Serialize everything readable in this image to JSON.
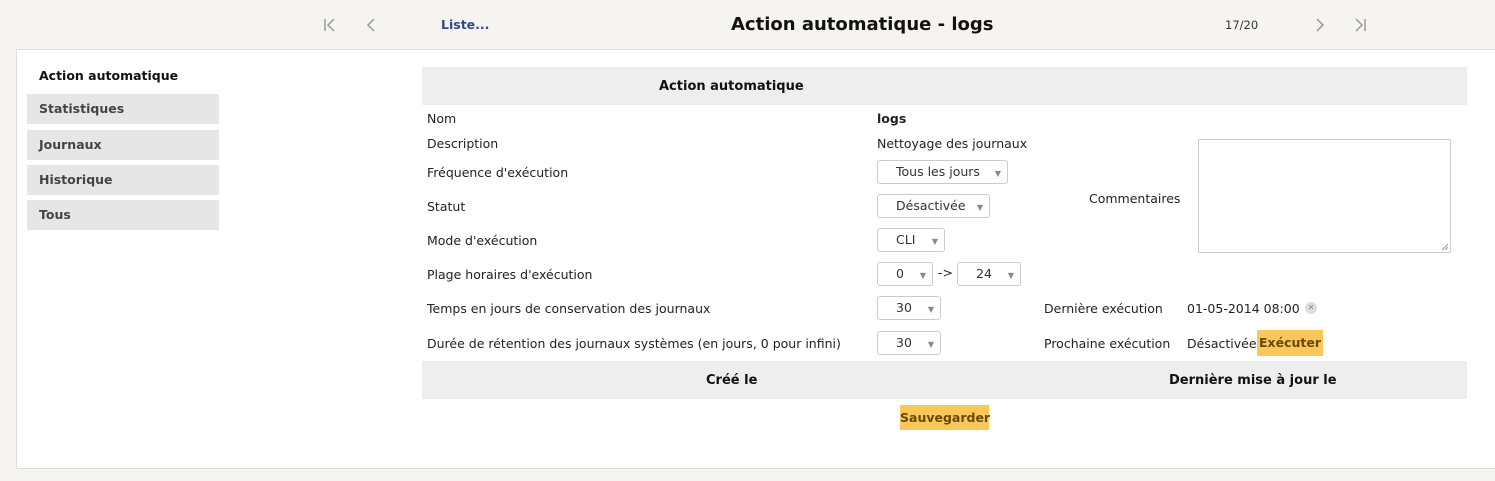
{
  "nav": {
    "list_label": "Liste...",
    "title": "Action automatique - logs",
    "counter": "17/20"
  },
  "sidebar": {
    "title": "Action automatique",
    "items": [
      {
        "label": "Statistiques"
      },
      {
        "label": "Journaux"
      },
      {
        "label": "Historique"
      },
      {
        "label": "Tous"
      }
    ]
  },
  "form": {
    "header": "Action automatique",
    "name_label": "Nom",
    "name_value": "logs",
    "description_label": "Description",
    "description_value": "Nettoyage des journaux",
    "frequency_label": "Fréquence d'exécution",
    "frequency_value": "Tous les jours",
    "status_label": "Statut",
    "status_value": "Désactivée",
    "mode_label": "Mode d'exécution",
    "mode_value": "CLI",
    "hours_label": "Plage horaires d'exécution",
    "hours_from": "0",
    "hours_sep": "->",
    "hours_to": "24",
    "keep_days_label": "Temps en jours de conservation des journaux",
    "keep_days_value": "30",
    "sys_retention_label": "Durée de rétention des journaux systèmes (en jours, 0 pour infini)",
    "sys_retention_value": "30",
    "comments_label": "Commentaires",
    "last_run_label": "Dernière exécution",
    "last_run_value": "01-05-2014 08:00",
    "next_run_label": "Prochaine exécution",
    "next_run_value": "Désactivée",
    "execute_label": "Exécuter",
    "created_label": "Créé le",
    "updated_label": "Dernière mise à jour le",
    "save_label": "Sauvegarder"
  }
}
